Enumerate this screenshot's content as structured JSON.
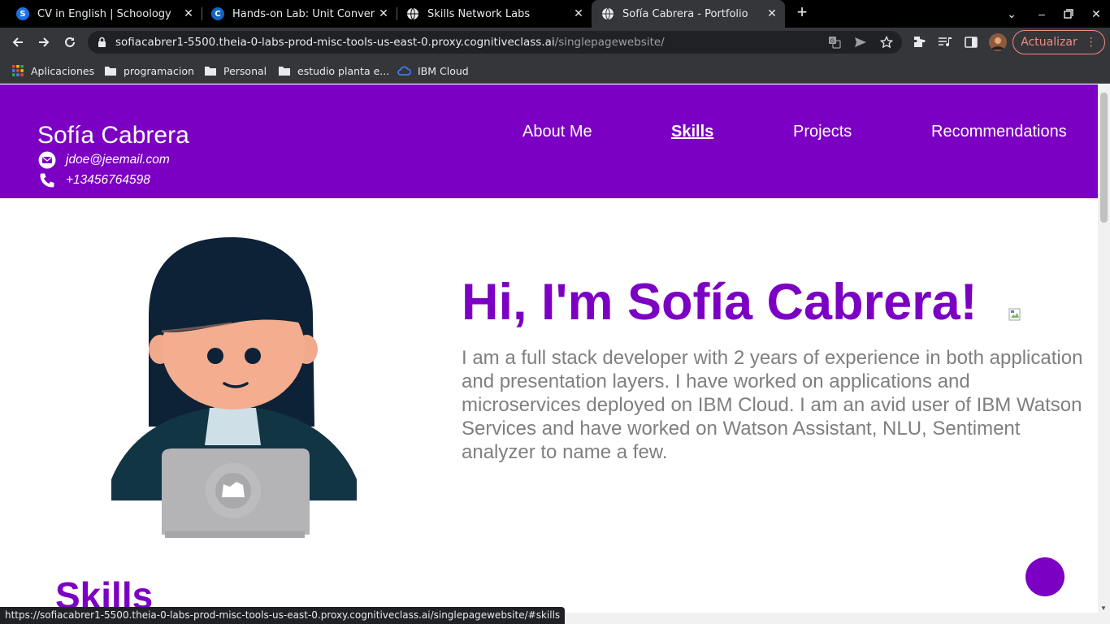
{
  "browser": {
    "tabs": [
      {
        "title": "CV in English | Schoology",
        "icon": "schoology-icon"
      },
      {
        "title": "Hands-on Lab: Unit Conversion",
        "icon": "cognitiveclass-icon"
      },
      {
        "title": "Skills Network Labs",
        "icon": "globe-icon"
      },
      {
        "title": "Sofía Cabrera - Portfolio",
        "icon": "globe-icon",
        "active": true
      }
    ],
    "url_host": "sofiacabrer1-5500.theia-0-labs-prod-misc-tools-us-east-0.proxy.cognitiveclass.ai",
    "url_path": "/singlepagewebsite/",
    "update_label": "Actualizar",
    "bookmarks": [
      {
        "label": "Aplicaciones",
        "icon": "apps-grid-icon"
      },
      {
        "label": "programacion",
        "icon": "folder-icon"
      },
      {
        "label": "Personal",
        "icon": "folder-icon"
      },
      {
        "label": "estudio planta e...",
        "icon": "folder-icon"
      },
      {
        "label": "IBM Cloud",
        "icon": "ibm-cloud-icon"
      }
    ],
    "status_url": "https://sofiacabrer1-5500.theia-0-labs-prod-misc-tools-us-east-0.proxy.cognitiveclass.ai/singlepagewebsite/#skills"
  },
  "site": {
    "name": "Sofía Cabrera",
    "email": "jdoe@jeemail.com",
    "phone": "+13456764598",
    "nav": [
      "About Me",
      "Skills",
      "Projects",
      "Recommendations"
    ],
    "active_nav": "Skills",
    "accent_color": "#7b00c3",
    "hero_title": "Hi, I'm Sofía Cabrera!",
    "hero_text": "I am a full stack developer with 2 years of experience in both application and presentation layers. I have worked on applications and microservices deployed on IBM Cloud. I am an avid user of IBM Watson Services and have worked on Watson Assistant, NLU, Sentiment analyzer to name a few.",
    "skills_heading": "Skills"
  }
}
